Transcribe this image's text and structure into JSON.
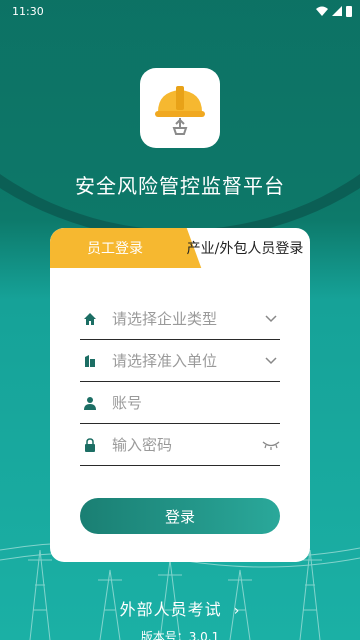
{
  "status_bar": {
    "time": "11:30"
  },
  "app": {
    "title": "安全风险管控监督平台"
  },
  "tabs": [
    {
      "label": "员工登录",
      "active": true
    },
    {
      "label": "产业/外包人员登录",
      "active": false
    }
  ],
  "form": {
    "enterprise_type_placeholder": "请选择企业类型",
    "unit_placeholder": "请选择准入单位",
    "account_placeholder": "账号",
    "password_placeholder": "输入密码"
  },
  "login_button": "登录",
  "external_exam": "外部人员考试",
  "version": "版本号：3.0.1",
  "colors": {
    "accent_orange": "#f6b830",
    "teal": "#1a7f73"
  },
  "icons": [
    "hard-hat-icon",
    "home-icon",
    "building-icon",
    "user-icon",
    "lock-icon",
    "chevron-down-icon",
    "eye-closed-icon",
    "chevron-right-icon"
  ]
}
